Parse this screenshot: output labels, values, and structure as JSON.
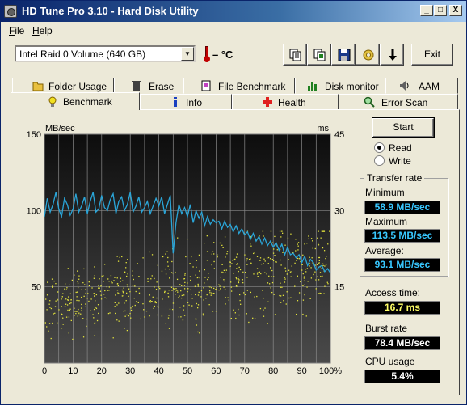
{
  "window": {
    "title": "HD Tune Pro 3.10 - Hard Disk Utility",
    "controls": {
      "minimize": "_",
      "maximize": "□",
      "close": "X"
    }
  },
  "menu": {
    "items": [
      "File",
      "Help"
    ]
  },
  "toolbar": {
    "drive": "Intel   Raid 0 Volume (640 GB)",
    "temperature": "– °C",
    "exit_label": "Exit",
    "buttons": [
      "copy-info",
      "copy-screen",
      "save",
      "options",
      "download"
    ]
  },
  "tabs": {
    "top": [
      "Folder Usage",
      "Erase",
      "File Benchmark",
      "Disk monitor",
      "AAM"
    ],
    "bottom": [
      "Benchmark",
      "Info",
      "Health",
      "Error Scan"
    ],
    "active": "Benchmark"
  },
  "controls": {
    "start_label": "Start",
    "read_label": "Read",
    "write_label": "Write",
    "selected": "Read"
  },
  "results": {
    "transfer_rate_title": "Transfer rate",
    "minimum_label": "Minimum",
    "minimum_value": "58.9 MB/sec",
    "maximum_label": "Maximum",
    "maximum_value": "113.5 MB/sec",
    "average_label": "Average:",
    "average_value": "93.1 MB/sec",
    "access_time_label": "Access time:",
    "access_time_value": "16.7 ms",
    "burst_rate_label": "Burst rate",
    "burst_rate_value": "78.4 MB/sec",
    "cpu_usage_label": "CPU usage",
    "cpu_usage_value": "5.4%"
  },
  "colors": {
    "transfer_line": "#2aa5d8",
    "access_points": "#e6e63c",
    "chart_bg_top": "#0d0d0d",
    "chart_bg_bottom": "#4a4a4a",
    "value_blue": "#38c8ff",
    "value_yellow": "#ffff66",
    "value_white": "#ffffff"
  },
  "chart_data": {
    "type": "line",
    "ylabel_left": "MB/sec",
    "ylabel_right": "ms",
    "ylim": [
      0,
      150
    ],
    "y2lim": [
      0,
      45
    ],
    "yticks_left": [
      "150",
      "100",
      "50"
    ],
    "yticks_right": [
      "45",
      "30",
      "15"
    ],
    "xlim": [
      0,
      100
    ],
    "xticks": [
      "0",
      "10",
      "20",
      "30",
      "40",
      "50",
      "60",
      "70",
      "80",
      "90",
      "100%"
    ],
    "grid": true,
    "series": [
      {
        "unit": "MB/sec",
        "x": [
          0,
          1,
          2,
          3,
          4,
          5,
          6,
          7,
          8,
          9,
          10,
          11,
          12,
          13,
          14,
          15,
          16,
          17,
          18,
          19,
          20,
          21,
          22,
          23,
          24,
          25,
          26,
          27,
          28,
          29,
          30,
          31,
          32,
          33,
          34,
          35,
          36,
          37,
          38,
          39,
          40,
          41,
          42,
          43,
          44,
          45,
          46,
          47,
          48,
          49,
          50,
          51,
          52,
          53,
          54,
          55,
          56,
          57,
          58,
          59,
          60,
          61,
          62,
          63,
          64,
          65,
          66,
          67,
          68,
          69,
          70,
          71,
          72,
          73,
          74,
          75,
          76,
          77,
          78,
          79,
          80,
          81,
          82,
          83,
          84,
          85,
          86,
          87,
          88,
          89,
          90,
          91,
          92,
          93,
          94,
          95,
          96,
          97,
          98,
          99,
          100
        ],
        "values": [
          96,
          108,
          99,
          104,
          112,
          101,
          96,
          108,
          104,
          97,
          101,
          111,
          99,
          103,
          109,
          98,
          106,
          112,
          99,
          101,
          110,
          102,
          100,
          107,
          111,
          98,
          106,
          109,
          100,
          104,
          112,
          99,
          103,
          109,
          99,
          102,
          106,
          98,
          103,
          108,
          103,
          109,
          98,
          104,
          110,
          72,
          92,
          104,
          98,
          102,
          96,
          104,
          92,
          100,
          95,
          99,
          90,
          96,
          91,
          94,
          92,
          93,
          88,
          93,
          89,
          91,
          86,
          90,
          85,
          88,
          84,
          86,
          81,
          85,
          80,
          83,
          78,
          82,
          77,
          80,
          76,
          79,
          74,
          78,
          71,
          76,
          71,
          72,
          69,
          71,
          66,
          70,
          64,
          68,
          66,
          61,
          63,
          64,
          60,
          62,
          59
        ]
      },
      {
        "unit": "ms",
        "type": "scatter",
        "point_count": 700,
        "x_range": [
          0,
          100
        ],
        "y_range_ms": [
          3,
          26
        ]
      }
    ]
  }
}
